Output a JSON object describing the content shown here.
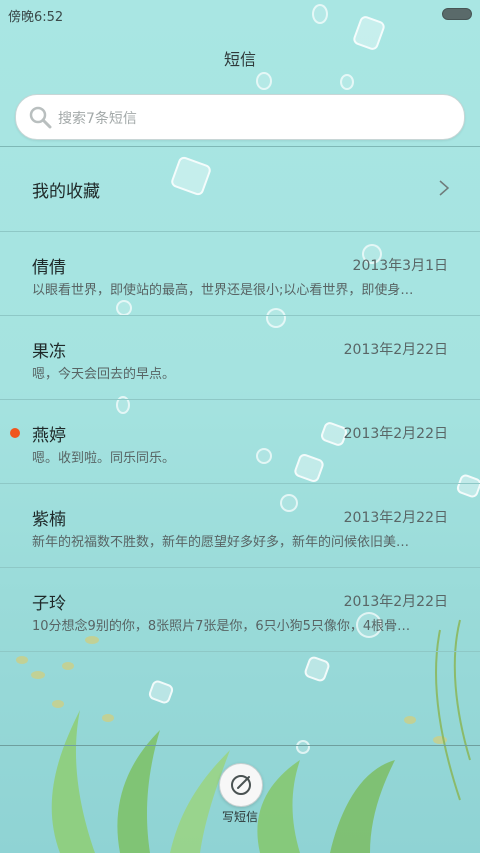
{
  "status_bar": {
    "time": "傍晚6:52"
  },
  "header": {
    "title": "短信"
  },
  "search": {
    "placeholder": "搜索7条短信"
  },
  "favorites": {
    "label": "我的收藏"
  },
  "conversations": [
    {
      "name": "倩倩",
      "date": "2013年3月1日",
      "preview": "以眼看世界，即使站的最高，世界还是很小;以心看世界，即使身…",
      "unread": false
    },
    {
      "name": "果冻",
      "date": "2013年2月22日",
      "preview": "嗯，今天会回去的早点。",
      "unread": false
    },
    {
      "name": "燕婷",
      "date": "2013年2月22日",
      "preview": "嗯。收到啦。同乐同乐。",
      "unread": true
    },
    {
      "name": "紫楠",
      "date": "2013年2月22日",
      "preview": "新年的祝福数不胜数，新年的愿望好多好多，新年的问候依旧美…",
      "unread": false
    },
    {
      "name": "子玲",
      "date": "2013年2月22日",
      "preview": "10分想念9别的你，8张照片7张是你，6只小狗5只像你，4根骨…",
      "unread": false
    }
  ],
  "compose": {
    "label": "写短信"
  },
  "colors": {
    "unread_dot": "#f0561e",
    "background": "#a9e6e3"
  }
}
